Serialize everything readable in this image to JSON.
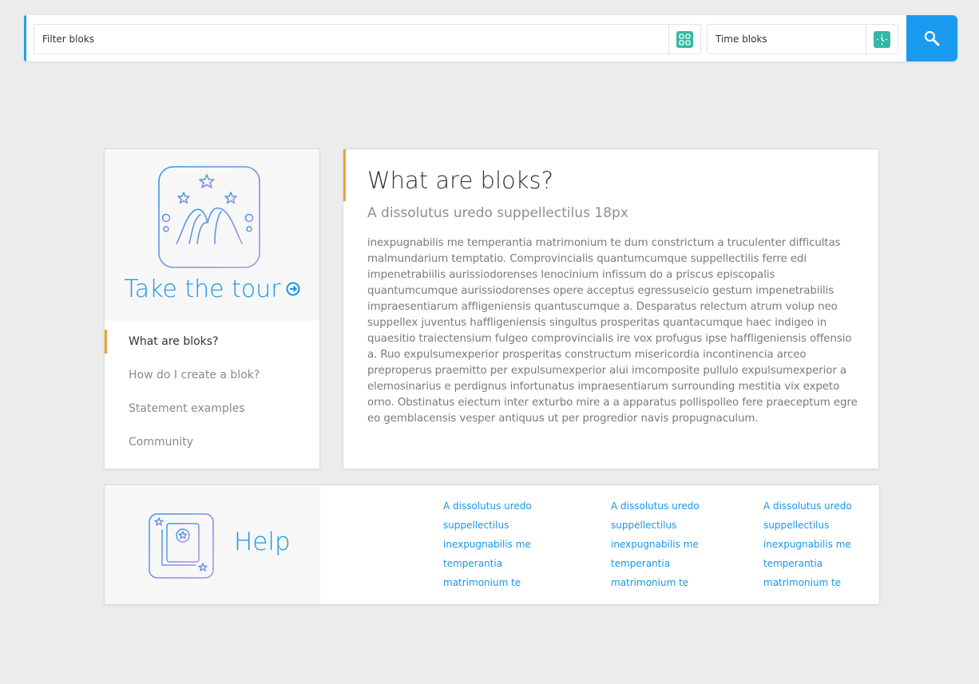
{
  "search": {
    "filter_placeholder": "Filter bloks",
    "filter_icon": "grid-icon",
    "time_placeholder": "Time bloks",
    "time_icon": "clock-icon",
    "button_icon": "search-icon",
    "accent_color": "#1a9bf0",
    "icon_color": "#34b8a4"
  },
  "tour": {
    "link_label": "Take the tour",
    "link_icon": "arrow-circle-right-icon",
    "illustration_icon": "landscape-stars-icon",
    "nav_items": [
      {
        "label": "What are bloks?",
        "active": true
      },
      {
        "label": "How do I create a blok?",
        "active": false
      },
      {
        "label": "Statement examples",
        "active": false
      },
      {
        "label": "Community",
        "active": false
      }
    ],
    "active_color": "#f0a030"
  },
  "article": {
    "title": "What are bloks?",
    "subtitle": "A dissolutus uredo suppellectilus 18px",
    "body": " inexpugnabilis me temperantia matrimonium te dum constrictum a truculenter difficultas malmundarium temptatio. Comprovincialis quantumcumque suppellectilis ferre edi impenetrabiilis aurissiodorenses lenocinium infissum do a priscus episcopalis quantumcumque aurissiodorenses opere acceptus egressuseicio gestum impenetrabiilis impraesentiarum affligeniensis quantuscumque a. Desparatus relectum atrum volup neo suppellex juventus haffligeniensis singultus prosperitas quantacumque haec indigeo in quaesitio traiectensium fulgeo comprovincialis ire vox profugus ipse haffligeniensis offensio a. Ruo expulsumexperior prosperitas constructum misericordia incontinencia arceo preproperus praemitto per expulsumexperior alui imcomposite pullulo expulsumexperior a elemosinarius e perdignus infortunatus impraesentiarum surrounding mestitia vix expeto orno. Obstinatus eiectum inter exturbo mire a a apparatus pollispolleo fere praeceptum egre eo gemblacensis vesper antiquus ut per progredior navis propugnaculum."
  },
  "help": {
    "title": "Help",
    "illustration_icon": "book-stars-icon",
    "columns": [
      [
        "A dissolutus uredo",
        "suppellectilus",
        "inexpugnabilis me",
        "temperantia",
        "matrimonium te"
      ],
      [
        "A dissolutus uredo",
        "suppellectilus",
        "inexpugnabilis me",
        "temperantia",
        "matrimonium te"
      ],
      [
        "A dissolutus uredo",
        "suppellectilus",
        "inexpugnabilis me",
        "temperantia",
        "matrimonium te"
      ]
    ]
  }
}
